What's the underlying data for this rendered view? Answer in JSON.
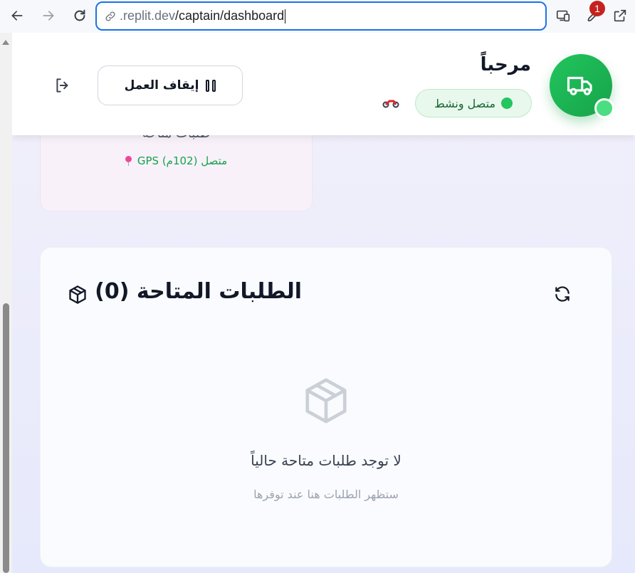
{
  "browser": {
    "url_dim": ".replit.dev",
    "url_path": "/captain/dashboard",
    "badge_count": "1"
  },
  "stat_card": {
    "label": "طلبات متاحة",
    "gps": "متصل (102م) GPS"
  },
  "header": {
    "welcome": "مرحباً",
    "status": "متصل ونشط",
    "stop_button": "إيقاف العمل"
  },
  "orders": {
    "title": "الطلبات المتاحة (0)",
    "empty_title": "لا توجد طلبات متاحة حالياً",
    "empty_subtitle": "ستظهر الطلبات هنا عند توفرها"
  },
  "colors": {
    "accent": "#22c55e",
    "url_focus": "#1a73e8"
  }
}
